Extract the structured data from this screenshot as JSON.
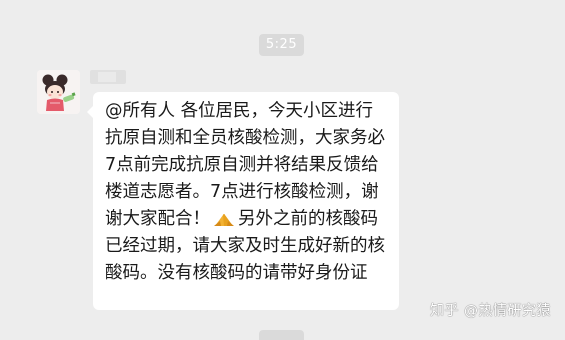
{
  "timestamp": "5:25",
  "sender": {
    "name": "",
    "avatar_icon": "cartoon-girl-avatar-icon"
  },
  "message": {
    "part1": "@所有人 各位居民，今天小区进行抗原自测和全员核酸检测，大家务必7点前完成抗原自测并将结果反馈给楼道志愿者。7点进行核酸检测，谢谢大家配合！",
    "emoji_icon": "folded-hands-icon",
    "part2": "另外之前的核酸码已经过期，请大家及时生成好新的核酸码。没有核酸码的请带好身份证"
  },
  "watermark": "知乎 @热情研究猿",
  "colors": {
    "background": "#ededed",
    "bubble": "#ffffff",
    "time_badge": "#dadada"
  }
}
